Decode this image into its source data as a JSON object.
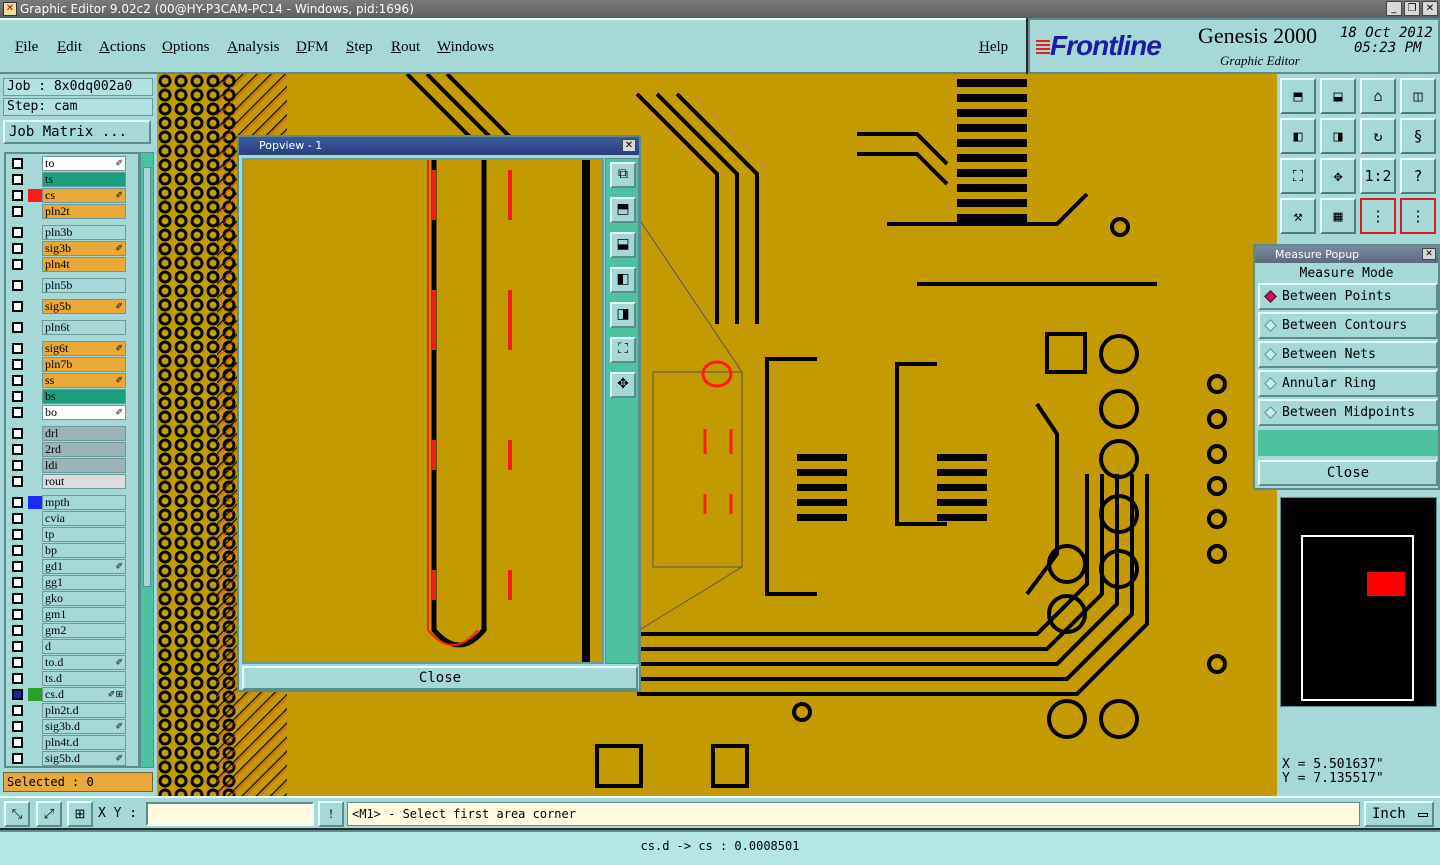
{
  "window": {
    "title": "Graphic Editor 9.02c2 (00@HY-P3CAM-PC14 - Windows, pid:1696)"
  },
  "menu": [
    "File",
    "Edit",
    "Actions",
    "Options",
    "Analysis",
    "DFM",
    "Step",
    "Rout",
    "Windows"
  ],
  "help_label": "Help",
  "brand": {
    "logo": "Frontline",
    "product": "Genesis 2000",
    "subtitle": "Graphic Editor",
    "date": "18 Oct 2012",
    "time": "05:23 PM"
  },
  "job": {
    "job_line": "Job : 8x0dq002a0",
    "step_line": "Step: cam",
    "matrix_button": "Job Matrix ..."
  },
  "layers": [
    {
      "name": "to",
      "bg": "#ffffff",
      "color": "",
      "flag": "✐"
    },
    {
      "name": "ts",
      "bg": "#1a9e7e",
      "color": "",
      "flag": ""
    },
    {
      "name": "cs",
      "bg": "#e9a93a",
      "color": "#ff1a1a",
      "flag": "✐"
    },
    {
      "name": "pln2t",
      "bg": "#e9a93a",
      "color": "",
      "flag": ""
    },
    {
      "name": "pln3b",
      "bg": "#a6d8d8",
      "color": "",
      "flag": ""
    },
    {
      "name": "sig3b",
      "bg": "#e9a93a",
      "color": "",
      "flag": "✐"
    },
    {
      "name": "pln4t",
      "bg": "#e9a93a",
      "color": "",
      "flag": ""
    },
    {
      "name": "pln5b",
      "bg": "#a6d8d8",
      "color": "",
      "flag": ""
    },
    {
      "name": "sig5b",
      "bg": "#e9a93a",
      "color": "",
      "flag": "✐"
    },
    {
      "name": "pln6t",
      "bg": "#a6d8d8",
      "color": "",
      "flag": ""
    },
    {
      "name": "sig6t",
      "bg": "#e9a93a",
      "color": "",
      "flag": "✐"
    },
    {
      "name": "pln7b",
      "bg": "#e9a93a",
      "color": "",
      "flag": ""
    },
    {
      "name": "ss",
      "bg": "#e9a93a",
      "color": "",
      "flag": "✐"
    },
    {
      "name": "bs",
      "bg": "#1a9e7e",
      "color": "",
      "flag": ""
    },
    {
      "name": "bo",
      "bg": "#ffffff",
      "color": "",
      "flag": "✐"
    },
    {
      "name": "drl",
      "bg": "#9ab4b8",
      "color": "",
      "flag": ""
    },
    {
      "name": "2rd",
      "bg": "#9ab4b8",
      "color": "",
      "flag": ""
    },
    {
      "name": "ldi",
      "bg": "#9ab4b8",
      "color": "",
      "flag": ""
    },
    {
      "name": "rout",
      "bg": "#dcdcdc",
      "color": "",
      "flag": ""
    },
    {
      "name": "mpth",
      "bg": "#a6d8d8",
      "color": "#1a2aff",
      "flag": ""
    },
    {
      "name": "cvia",
      "bg": "#a6d8d8",
      "color": "",
      "flag": ""
    },
    {
      "name": "tp",
      "bg": "#a6d8d8",
      "color": "",
      "flag": ""
    },
    {
      "name": "bp",
      "bg": "#a6d8d8",
      "color": "",
      "flag": ""
    },
    {
      "name": "gd1",
      "bg": "#a6d8d8",
      "color": "",
      "flag": "✐"
    },
    {
      "name": "gg1",
      "bg": "#a6d8d8",
      "color": "",
      "flag": ""
    },
    {
      "name": "gko",
      "bg": "#a6d8d8",
      "color": "",
      "flag": ""
    },
    {
      "name": "gm1",
      "bg": "#a6d8d8",
      "color": "",
      "flag": ""
    },
    {
      "name": "gm2",
      "bg": "#a6d8d8",
      "color": "",
      "flag": ""
    },
    {
      "name": "d",
      "bg": "#a6d8d8",
      "color": "",
      "flag": ""
    },
    {
      "name": "to.d",
      "bg": "#a6d8d8",
      "color": "",
      "flag": "✐"
    },
    {
      "name": "ts.d",
      "bg": "#a6d8d8",
      "color": "",
      "flag": ""
    },
    {
      "name": "cs.d",
      "bg": "#a6d8d8",
      "color": "#2aa02a",
      "flag": "✐⊞"
    },
    {
      "name": "pln2t.d",
      "bg": "#a6d8d8",
      "color": "",
      "flag": ""
    },
    {
      "name": "sig3b.d",
      "bg": "#a6d8d8",
      "color": "",
      "flag": "✐"
    },
    {
      "name": "pln4t.d",
      "bg": "#a6d8d8",
      "color": "",
      "flag": ""
    },
    {
      "name": "sig5b.d",
      "bg": "#a6d8d8",
      "color": "",
      "flag": "✐"
    }
  ],
  "selected_text": "Selected : 0",
  "popview": {
    "title": "Popview - 1",
    "close_label": "Close"
  },
  "measure": {
    "title": "Measure Popup",
    "mode_label": "Measure Mode",
    "options": [
      "Between Points",
      "Between Contours",
      "Between Nets",
      "Annular Ring",
      "Between Midpoints"
    ],
    "selected_index": 0,
    "close_label": "Close"
  },
  "toolbar_icons": [
    "open-icon",
    "save-icon",
    "home-icon",
    "window-icon",
    "zoom-in-icon",
    "zoom-out-icon",
    "rotate-icon",
    "snap-icon",
    "fit-icon",
    "center-icon",
    "scale-label",
    "help-icon",
    "tools-icon",
    "grid-icon",
    "layers-icon",
    "nets-icon"
  ],
  "scale_label": "1:2",
  "coords": {
    "x": "X = 5.501637\"",
    "y": "Y = 7.135517\""
  },
  "xy_label": "X Y :",
  "xy_value": "",
  "prompt": "<M1> - Select first area corner",
  "units": "Inch",
  "status": "cs.d -> cs : 0.0008501",
  "colors": {
    "board": "#c39b00",
    "panel": "#a6d8d8",
    "trace": "#000000",
    "highlight": "#ff1a1a"
  }
}
